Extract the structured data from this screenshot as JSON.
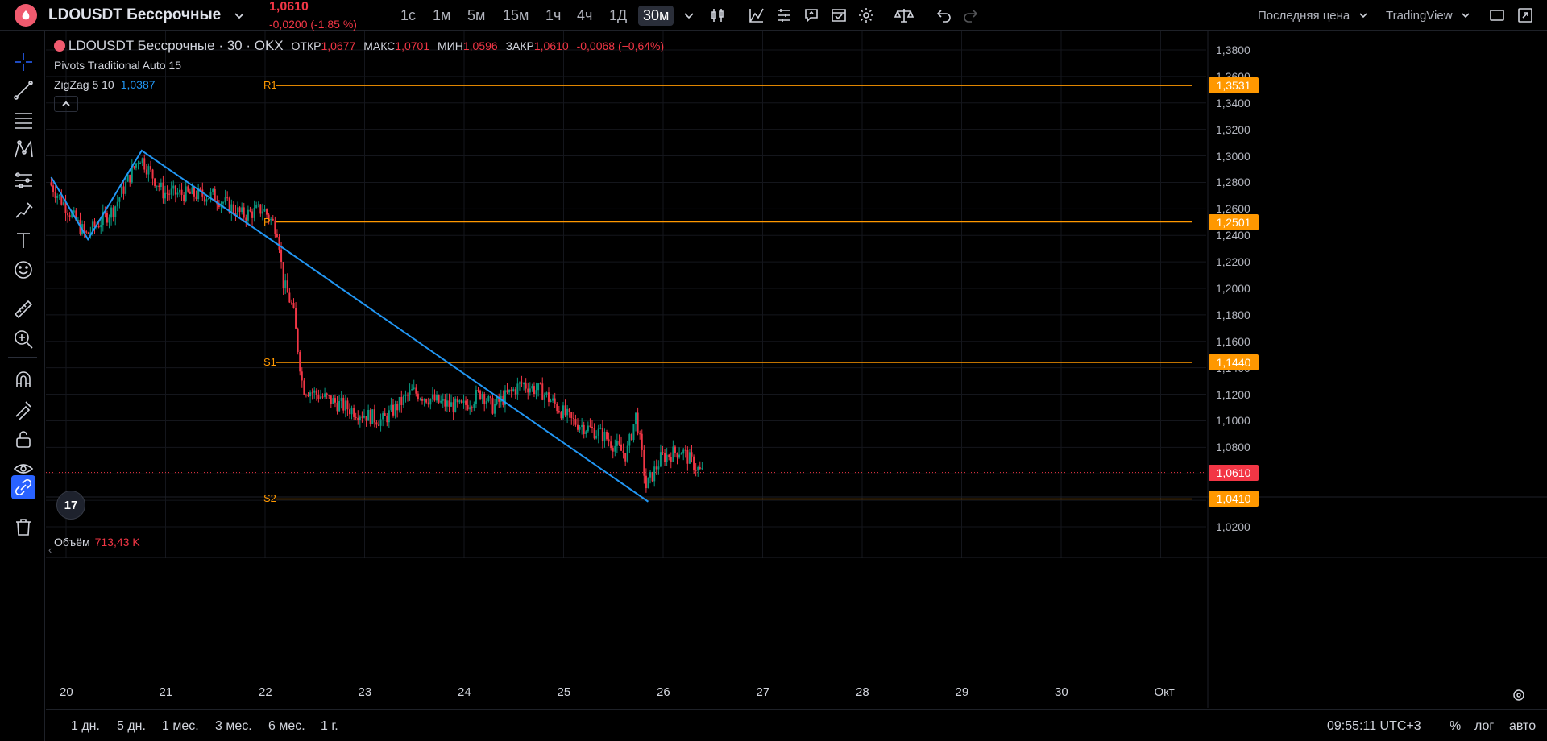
{
  "header": {
    "symbol": "LDOUSDT Бессрочные",
    "last_price": "1,0610",
    "change": "-0,0200 (-1,85 %)",
    "timeframes": [
      "1с",
      "1м",
      "5м",
      "15м",
      "1ч",
      "4ч",
      "1Д",
      "30м"
    ],
    "active_timeframe": "30м",
    "price_source": "Последняя цена",
    "chart_style": "TradingView"
  },
  "legend": {
    "symbol_line": "LDOUSDT Бессрочные · 30 · OKX",
    "open_label": "ОТКР",
    "open": "1,0677",
    "high_label": "МАКС",
    "high": "1,0701",
    "low_label": "МИН",
    "low": "1,0596",
    "close_label": "ЗАКР",
    "close": "1,0610",
    "change": "-0,0068 (−0,64%)",
    "pivots": "Pivots Traditional Auto 15",
    "zigzag": "ZigZag 5 10",
    "zigzag_value": "1,0387"
  },
  "volume": {
    "label": "Объём",
    "value": "713,43 K"
  },
  "bottom": {
    "ranges": [
      "1 дн.",
      "5 дн.",
      "1 мес.",
      "3 мес.",
      "6 мес.",
      "1 г."
    ],
    "time": "09:55:11 UTC+3",
    "percent": "%",
    "log": "лог",
    "auto": "авто"
  },
  "colors": {
    "up": "#089981",
    "down": "#f23645",
    "pivot": "#ff9800",
    "zigzag": "#2196f3",
    "accent": "#2962ff"
  },
  "chart_data": {
    "type": "candlestick",
    "title": "LDOUSDT Бессрочные · 30 · OKX",
    "y_ticks": [
      "1,3800",
      "1,3600",
      "1,3400",
      "1,3200",
      "1,3000",
      "1,2800",
      "1,2600",
      "1,2400",
      "1,2200",
      "1,2000",
      "1,1800",
      "1,1600",
      "1,1400",
      "1,1200",
      "1,1000",
      "1,0800",
      "1,0600",
      "1,0400",
      "1,0200"
    ],
    "x_ticks": [
      "20",
      "21",
      "22",
      "23",
      "24",
      "25",
      "26",
      "27",
      "28",
      "29",
      "30",
      "Окт"
    ],
    "ylim": [
      1.01,
      1.385
    ],
    "pivot_levels": [
      {
        "name": "R1",
        "value": 1.3531,
        "label": "1,3531"
      },
      {
        "name": "P",
        "value": 1.2501,
        "label": "1,2501"
      },
      {
        "name": "S1",
        "value": 1.144,
        "label": "1,1440"
      },
      {
        "name": "S2",
        "value": 1.041,
        "label": "1,0410"
      }
    ],
    "last_price": {
      "value": 1.061,
      "label": "1,0610"
    },
    "zigzag_points": [
      {
        "day": 19.85,
        "price": 1.284
      },
      {
        "day": 20.22,
        "price": 1.237
      },
      {
        "day": 20.76,
        "price": 1.304
      },
      {
        "day": 22.15,
        "price": 1.232
      },
      {
        "day": 25.85,
        "price": 1.039
      }
    ],
    "price_path": [
      {
        "day": 19.85,
        "price": 1.28
      },
      {
        "day": 20.22,
        "price": 1.24
      },
      {
        "day": 20.5,
        "price": 1.26
      },
      {
        "day": 20.76,
        "price": 1.3
      },
      {
        "day": 21.0,
        "price": 1.272
      },
      {
        "day": 21.5,
        "price": 1.27
      },
      {
        "day": 21.8,
        "price": 1.255
      },
      {
        "day": 22.0,
        "price": 1.26
      },
      {
        "day": 22.15,
        "price": 1.244
      },
      {
        "day": 22.2,
        "price": 1.205
      },
      {
        "day": 22.3,
        "price": 1.185
      },
      {
        "day": 22.4,
        "price": 1.125
      },
      {
        "day": 22.6,
        "price": 1.118
      },
      {
        "day": 22.9,
        "price": 1.108
      },
      {
        "day": 23.2,
        "price": 1.1
      },
      {
        "day": 23.5,
        "price": 1.122
      },
      {
        "day": 23.8,
        "price": 1.113
      },
      {
        "day": 24.0,
        "price": 1.11
      },
      {
        "day": 24.2,
        "price": 1.122
      },
      {
        "day": 24.3,
        "price": 1.11
      },
      {
        "day": 24.6,
        "price": 1.128
      },
      {
        "day": 24.8,
        "price": 1.122
      },
      {
        "day": 25.1,
        "price": 1.1
      },
      {
        "day": 25.4,
        "price": 1.09
      },
      {
        "day": 25.65,
        "price": 1.074
      },
      {
        "day": 25.75,
        "price": 1.105
      },
      {
        "day": 25.85,
        "price": 1.05
      },
      {
        "day": 26.0,
        "price": 1.072
      },
      {
        "day": 26.2,
        "price": 1.078
      },
      {
        "day": 26.4,
        "price": 1.061
      }
    ]
  }
}
